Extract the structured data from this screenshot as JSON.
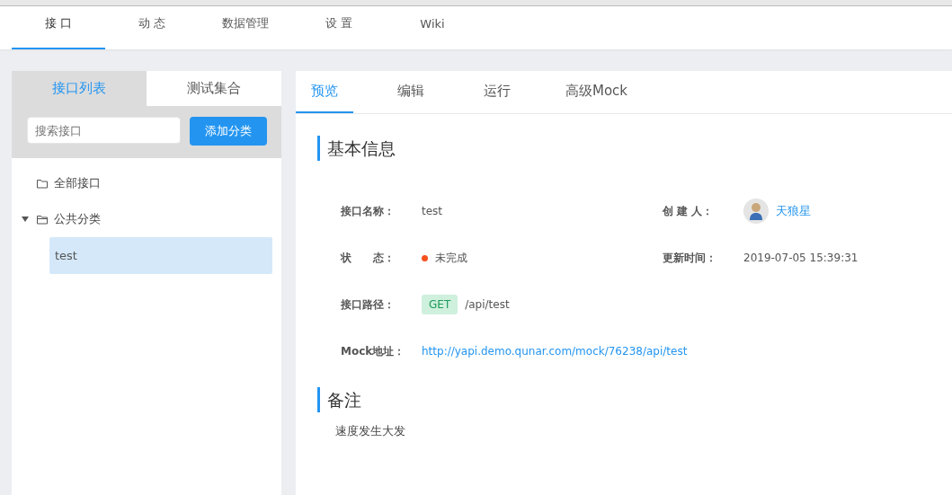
{
  "nav": [
    {
      "label": "接 口",
      "selected": true
    },
    {
      "label": "动 态",
      "selected": false
    },
    {
      "label": "数据管理",
      "selected": false
    },
    {
      "label": "设 置",
      "selected": false
    },
    {
      "label": "Wiki",
      "selected": false
    }
  ],
  "sidebar": {
    "tabs": [
      {
        "label": "接口列表",
        "selected": true
      },
      {
        "label": "测试集合",
        "selected": false
      }
    ],
    "search": {
      "placeholder": "搜索接口"
    },
    "add_button": "添加分类",
    "tree": [
      {
        "label": "全部接口",
        "expanded": false,
        "selected": false
      },
      {
        "label": "公共分类",
        "expanded": true,
        "selected": false,
        "children": [
          {
            "label": "test",
            "selected": true
          }
        ]
      }
    ]
  },
  "content": {
    "tabs": [
      {
        "label": "预览",
        "selected": true
      },
      {
        "label": "编辑",
        "selected": false
      },
      {
        "label": "运行",
        "selected": false
      },
      {
        "label": "高级Mock",
        "selected": false
      }
    ],
    "basic_title": "基本信息",
    "name_label": "接口名称：",
    "name": "test",
    "creator_label": "创 建 人：",
    "creator": "天狼星",
    "status_label": "状　　态：",
    "status": "未完成",
    "updated_label": "更新时间：",
    "updated": "2019-07-05 15:39:31",
    "path_label": "接口路径：",
    "method": "GET",
    "path": "/api/test",
    "mock_label": "Mock地址：",
    "mock_url": "http://yapi.demo.qunar.com/mock/76238/api/test",
    "remark_title": "备注",
    "remark": "速度发生大发"
  }
}
